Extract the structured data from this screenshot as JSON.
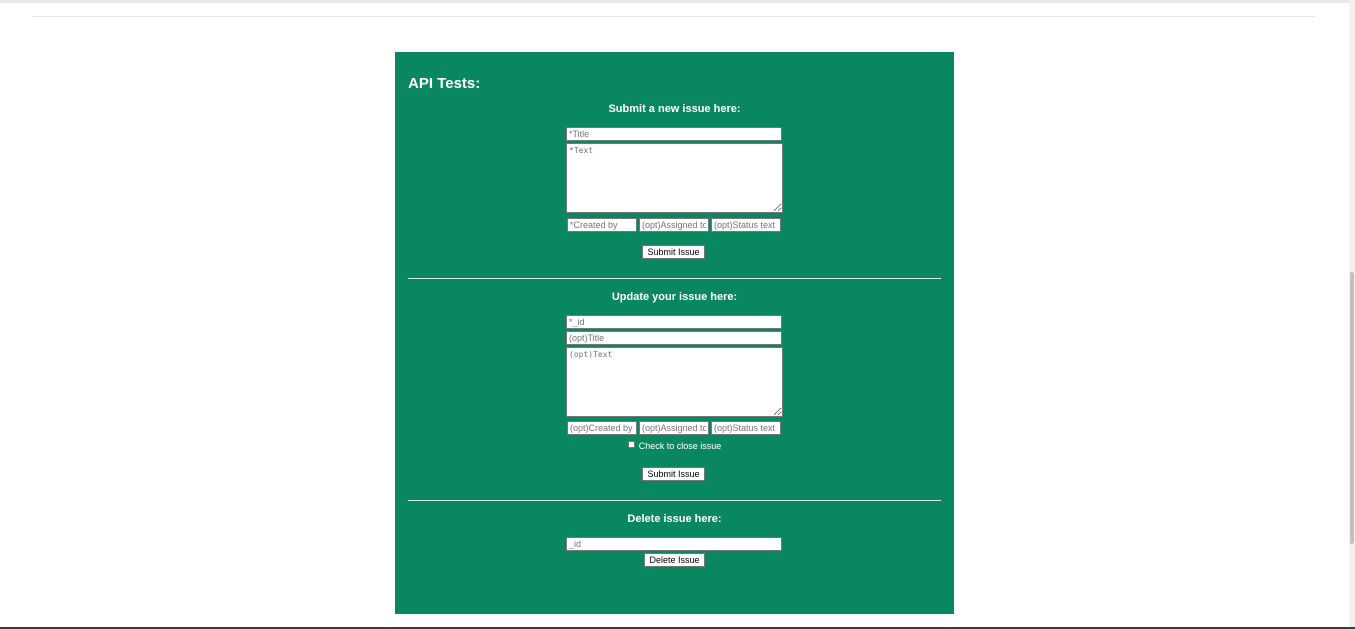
{
  "panel": {
    "heading": "API Tests:",
    "bg_color": "#088760"
  },
  "new_issue": {
    "title": "Submit a new issue here:",
    "title_placeholder": "*Title",
    "text_placeholder": "*Text",
    "created_by_placeholder": "*Created by",
    "assigned_to_placeholder": "(opt)Assigned to",
    "status_text_placeholder": "(opt)Status text",
    "submit_label": "Submit Issue"
  },
  "update_issue": {
    "title": "Update your issue here:",
    "id_placeholder": "*_id",
    "title_placeholder": "(opt)Title",
    "text_placeholder": "(opt)Text",
    "created_by_placeholder": "(opt)Created by",
    "assigned_to_placeholder": "(opt)Assigned to",
    "status_text_placeholder": "(opt)Status text",
    "close_label": "Check to close issue",
    "submit_label": "Submit Issue"
  },
  "delete_issue": {
    "title": "Delete issue here:",
    "id_placeholder": "_id",
    "delete_label": "Delete Issue"
  }
}
